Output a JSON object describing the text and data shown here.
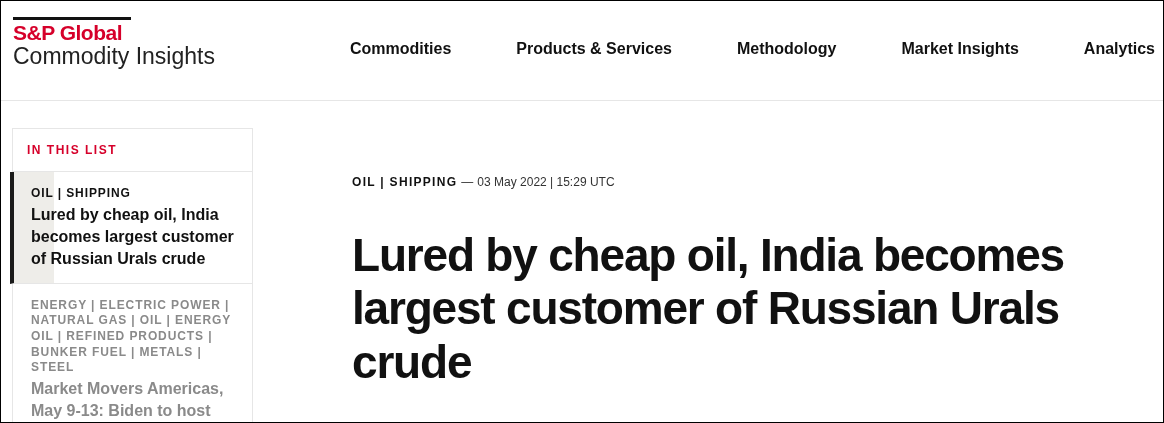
{
  "header": {
    "logo": {
      "brand": "S&P Global",
      "subtitle": "Commodity Insights"
    },
    "nav": [
      "Commodities",
      "Products & Services",
      "Methodology",
      "Market Insights",
      "Analytics"
    ]
  },
  "sidebar": {
    "heading": "IN THIS LIST",
    "items": [
      {
        "tags": "OIL | SHIPPING",
        "title": "Lured by cheap oil, India becomes largest customer of Russian Urals crude",
        "selected": true
      },
      {
        "tags": "ENERGY | ELECTRIC POWER | NATURAL GAS | OIL | ENERGY OIL | REFINED PRODUCTS | BUNKER FUEL | METALS | STEEL",
        "title": "Market Movers Americas, May 9-13: Biden to host",
        "selected": false
      }
    ]
  },
  "article": {
    "tags": "OIL | SHIPPING",
    "separator": "—",
    "dateline": "03 May 2022 | 15:29 UTC",
    "headline": "Lured by cheap oil, India becomes largest customer of Russian Urals crude"
  }
}
